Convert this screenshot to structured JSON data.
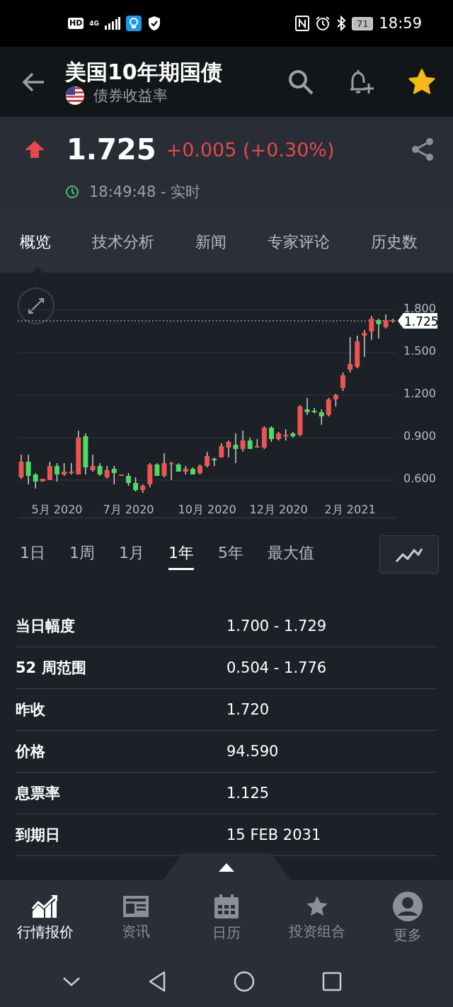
{
  "status_bar": {
    "hd": "HD",
    "network": "4G",
    "battery": "71",
    "time": "18:59"
  },
  "header": {
    "title": "美国10年期国债",
    "subtitle": "债券收益率",
    "favorite": true
  },
  "quote": {
    "price": "1.725",
    "change": "+0.005 (+0.30%)",
    "rising": true,
    "time": "18:49:48 - 实时"
  },
  "tabs": [
    {
      "label": "概览",
      "selected": true
    },
    {
      "label": "技术分析",
      "selected": false
    },
    {
      "label": "新闻",
      "selected": false
    },
    {
      "label": "专家评论",
      "selected": false
    },
    {
      "label": "历史数",
      "selected": false
    }
  ],
  "chart": {
    "chart_data": {
      "type": "candlestick",
      "grid": true,
      "ylim": [
        0.335,
        1.8
      ],
      "ref_lines": [
        {
          "axis": "y",
          "value": 1.725,
          "label": "1.725"
        }
      ],
      "categories": [
        null,
        null,
        null,
        null,
        null,
        "5月 2020",
        null,
        null,
        null,
        null,
        null,
        null,
        null,
        null,
        null,
        "7月 2020",
        null,
        null,
        null,
        null,
        null,
        null,
        null,
        null,
        null,
        null,
        "10月 2020",
        null,
        null,
        null,
        null,
        null,
        null,
        null,
        null,
        null,
        "12月 2020",
        null,
        null,
        null,
        null,
        null,
        null,
        null,
        null,
        null,
        "2月 2021",
        null,
        null,
        null,
        null,
        null,
        null
      ],
      "ohlc": [
        [
          0.62,
          0.78,
          0.61,
          0.73
        ],
        [
          0.73,
          0.78,
          0.57,
          0.63
        ],
        [
          0.64,
          0.65,
          0.54,
          0.59
        ],
        [
          0.59,
          0.61,
          0.59,
          0.61
        ],
        [
          0.6,
          0.73,
          0.6,
          0.7
        ],
        [
          0.7,
          0.72,
          0.59,
          0.64
        ],
        [
          0.64,
          0.72,
          0.63,
          0.66
        ],
        [
          0.65,
          0.72,
          0.64,
          0.66
        ],
        [
          0.64,
          0.95,
          0.64,
          0.9
        ],
        [
          0.91,
          0.93,
          0.64,
          0.69
        ],
        [
          0.67,
          0.78,
          0.66,
          0.7
        ],
        [
          0.7,
          0.72,
          0.63,
          0.64
        ],
        [
          0.62,
          0.7,
          0.61,
          0.67
        ],
        [
          0.68,
          0.7,
          0.57,
          0.65
        ],
        [
          0.63,
          0.64,
          0.63,
          0.64
        ],
        [
          0.63,
          0.65,
          0.56,
          0.58
        ],
        [
          0.58,
          0.62,
          0.52,
          0.53
        ],
        [
          0.53,
          0.57,
          0.51,
          0.56
        ],
        [
          0.57,
          0.72,
          0.55,
          0.71
        ],
        [
          0.71,
          0.72,
          0.63,
          0.63
        ],
        [
          0.63,
          0.79,
          0.62,
          0.72
        ],
        [
          0.72,
          0.73,
          0.6,
          0.72
        ],
        [
          0.71,
          0.72,
          0.66,
          0.66
        ],
        [
          0.66,
          0.7,
          0.64,
          0.68
        ],
        [
          0.68,
          0.69,
          0.64,
          0.64
        ],
        [
          0.65,
          0.71,
          0.64,
          0.7
        ],
        [
          0.7,
          0.8,
          0.69,
          0.77
        ],
        [
          0.75,
          0.76,
          0.7,
          0.74
        ],
        [
          0.76,
          0.86,
          0.76,
          0.84
        ],
        [
          0.83,
          0.88,
          0.76,
          0.87
        ],
        [
          0.85,
          0.93,
          0.72,
          0.82
        ],
        [
          0.82,
          0.95,
          0.8,
          0.88
        ],
        [
          0.88,
          0.9,
          0.82,
          0.82
        ],
        [
          0.83,
          0.89,
          0.83,
          0.84
        ],
        [
          0.83,
          0.98,
          0.82,
          0.97
        ],
        [
          0.97,
          0.98,
          0.87,
          0.89
        ],
        [
          0.89,
          0.94,
          0.88,
          0.93
        ],
        [
          0.91,
          0.96,
          0.88,
          0.92
        ],
        [
          0.93,
          0.94,
          0.9,
          0.91
        ],
        [
          0.92,
          1.13,
          0.91,
          1.12
        ],
        [
          1.1,
          1.18,
          1.06,
          1.08
        ],
        [
          1.09,
          1.11,
          1.07,
          1.08
        ],
        [
          1.08,
          1.1,
          0.99,
          1.05
        ],
        [
          1.06,
          1.18,
          1.05,
          1.17
        ],
        [
          1.17,
          1.21,
          1.12,
          1.2
        ],
        [
          1.25,
          1.36,
          1.23,
          1.34
        ],
        [
          1.38,
          1.61,
          1.36,
          1.42
        ],
        [
          1.4,
          1.62,
          1.39,
          1.58
        ],
        [
          1.62,
          1.66,
          1.47,
          1.64
        ],
        [
          1.65,
          1.76,
          1.59,
          1.74
        ],
        [
          1.73,
          1.74,
          1.6,
          1.7
        ],
        [
          1.68,
          1.77,
          1.67,
          1.73
        ],
        [
          1.72,
          1.74,
          1.71,
          1.73
        ]
      ],
      "yticks": [
        {
          "value": 1.8,
          "label": "1.800"
        },
        {
          "value": 1.5,
          "label": "1.500"
        },
        {
          "value": 1.2,
          "label": "1.200"
        },
        {
          "value": 0.9,
          "label": "0.900"
        },
        {
          "value": 0.6,
          "label": "0.600"
        }
      ]
    }
  },
  "periods": [
    {
      "label": "1日",
      "selected": false
    },
    {
      "label": "1周",
      "selected": false
    },
    {
      "label": "1月",
      "selected": false
    },
    {
      "label": "1年",
      "selected": true
    },
    {
      "label": "5年",
      "selected": false
    },
    {
      "label": "最大值",
      "selected": false
    }
  ],
  "stats": [
    {
      "label": "当日幅度",
      "value": "1.700 - 1.729"
    },
    {
      "label": "52 周范围",
      "value": "0.504 - 1.776"
    },
    {
      "label": "昨收",
      "value": "1.720"
    },
    {
      "label": "价格",
      "value": "94.590"
    },
    {
      "label": "息票率",
      "value": "1.125"
    },
    {
      "label": "到期日",
      "value": "15 FEB 2031"
    }
  ],
  "bottom_nav": [
    {
      "kind": "quotes",
      "label": "行情报价",
      "selected": true
    },
    {
      "kind": "news",
      "label": "资讯",
      "selected": false
    },
    {
      "kind": "calendar",
      "label": "日历",
      "selected": false
    },
    {
      "kind": "portfolio",
      "label": "投资组合",
      "selected": false
    },
    {
      "kind": "profile",
      "label": "更多",
      "selected": false
    }
  ]
}
